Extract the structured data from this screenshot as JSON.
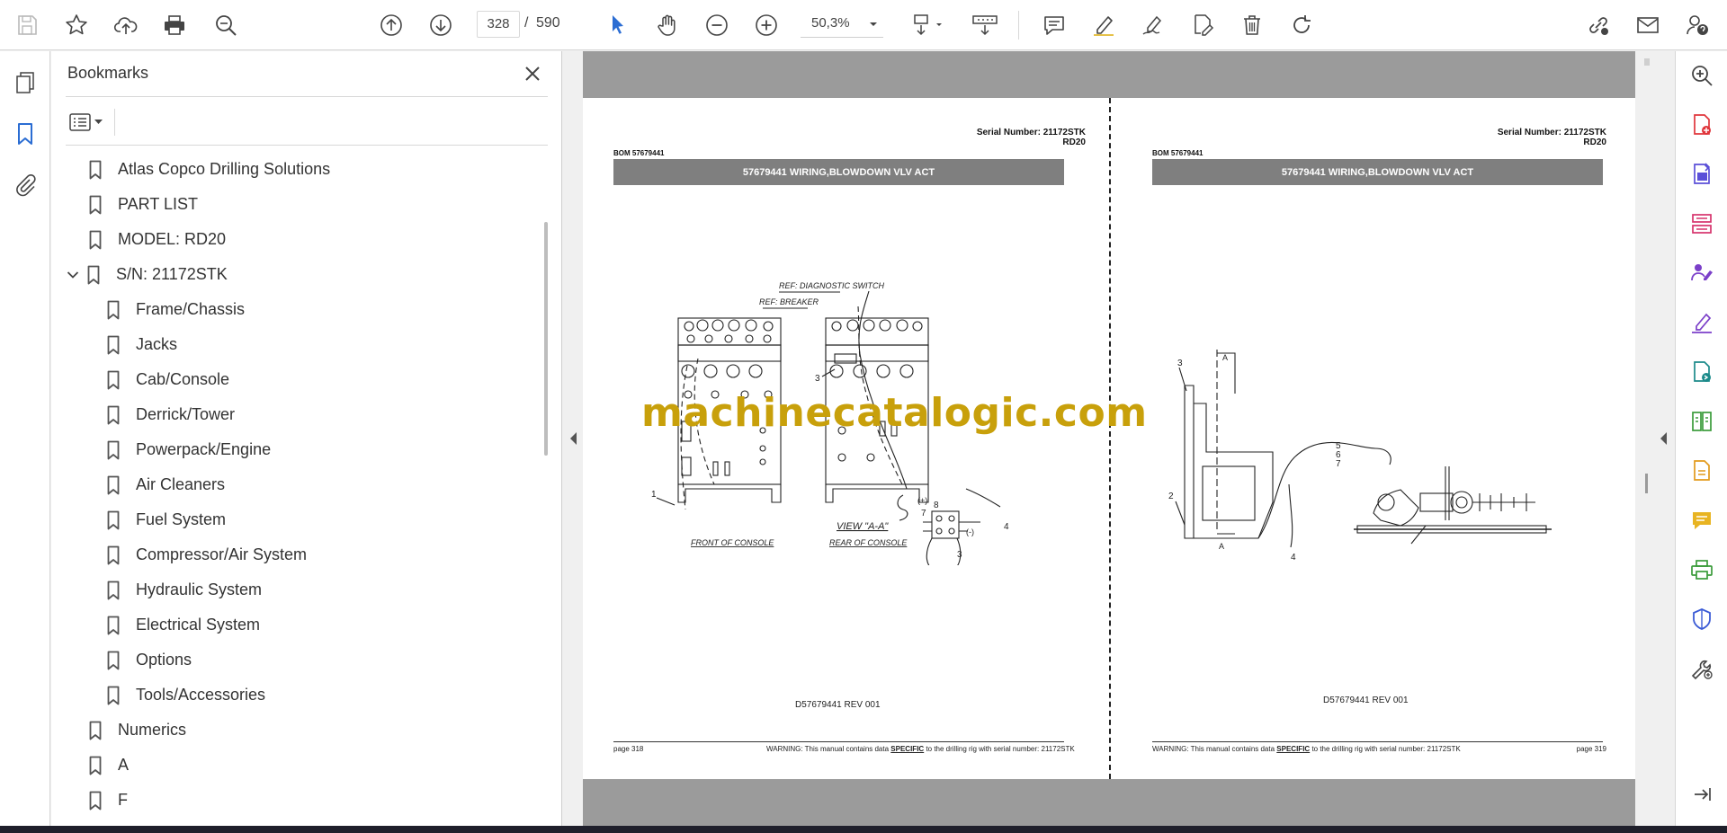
{
  "toolbar": {
    "current_page": "328",
    "page_separator": "/",
    "total_pages": "590",
    "zoom": "50,3%"
  },
  "bookmarks": {
    "title": "Bookmarks",
    "items": [
      {
        "label": "Atlas Copco Drilling Solutions",
        "level": 0
      },
      {
        "label": "PART LIST",
        "level": 0
      },
      {
        "label": "MODEL: RD20",
        "level": 0
      },
      {
        "label": "S/N: 21172STK",
        "level": 0,
        "expanded": true
      },
      {
        "label": "Frame/Chassis",
        "level": 1
      },
      {
        "label": "Jacks",
        "level": 1
      },
      {
        "label": "Cab/Console",
        "level": 1
      },
      {
        "label": "Derrick/Tower",
        "level": 1
      },
      {
        "label": "Powerpack/Engine",
        "level": 1
      },
      {
        "label": "Air Cleaners",
        "level": 1
      },
      {
        "label": "Fuel System",
        "level": 1
      },
      {
        "label": "Compressor/Air System",
        "level": 1
      },
      {
        "label": "Hydraulic System",
        "level": 1
      },
      {
        "label": "Electrical System",
        "level": 1
      },
      {
        "label": "Options",
        "level": 1
      },
      {
        "label": "Tools/Accessories",
        "level": 1
      },
      {
        "label": "Numerics",
        "level": 0
      },
      {
        "label": "A",
        "level": 0
      },
      {
        "label": "F",
        "level": 0
      }
    ]
  },
  "doc": {
    "left_page": {
      "serial": "Serial Number: 21172STK",
      "model": "RD20",
      "bom": "BOM 57679441",
      "title": "57679441 WIRING,BLOWDOWN VLV ACT",
      "drawing_no": "D57679441 REV 001",
      "page_label": "page 318",
      "warning_prefix": "WARNING:  This manual contains data",
      "warning_emph": "SPECIFIC",
      "warning_suffix": "to the drilling rig with serial number: 21172STK",
      "sketch": {
        "ref_diag": "REF: DIAGNOSTIC SWITCH",
        "ref_breaker": "REF: BREAKER",
        "front": "FRONT OF CONSOLE",
        "rear": "REAR OF CONSOLE",
        "view": "VIEW \"A-A\"",
        "callouts": [
          "1",
          "3",
          "8",
          "7",
          "4",
          "3",
          "(+)",
          "(-)"
        ]
      }
    },
    "right_page": {
      "serial": "Serial Number: 21172STK",
      "model": "RD20",
      "bom": "BOM 57679441",
      "title": "57679441 WIRING,BLOWDOWN VLV ACT",
      "drawing_no": "D57679441 REV 001",
      "page_label": "page 319",
      "warning_prefix": "WARNING:  This manual contains data",
      "warning_emph": "SPECIFIC",
      "warning_suffix": "to the drilling rig with serial number: 21172STK",
      "sketch": {
        "callouts": [
          "3",
          "2",
          "5",
          "6",
          "7",
          "4"
        ],
        "section_a_top": "A",
        "section_a_bottom": "A"
      }
    },
    "watermark": "machinecatalogic.com"
  }
}
